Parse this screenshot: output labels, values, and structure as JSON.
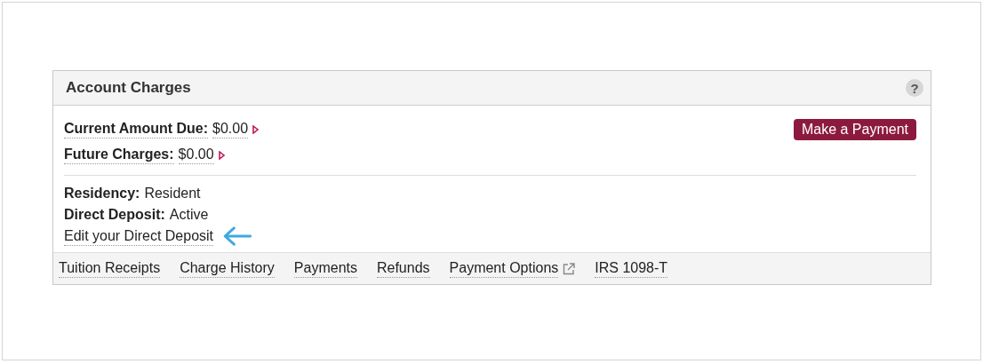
{
  "panel": {
    "title": "Account Charges",
    "help": "?"
  },
  "amounts": [
    {
      "label": "Current Amount Due:",
      "value": "$0.00"
    },
    {
      "label": "Future Charges:",
      "value": "$0.00"
    }
  ],
  "pay_button": "Make a Payment",
  "details": [
    {
      "label": "Residency:",
      "value": "Resident"
    },
    {
      "label": "Direct Deposit:",
      "value": "Active"
    }
  ],
  "edit_link": {
    "label": "Edit your Direct Deposit",
    "pointer_arrow": true
  },
  "footer_links": [
    {
      "label": "Tuition Receipts",
      "external": false
    },
    {
      "label": "Charge History",
      "external": false
    },
    {
      "label": "Payments",
      "external": false
    },
    {
      "label": "Refunds",
      "external": false
    },
    {
      "label": "Payment Options",
      "external": true
    },
    {
      "label": "IRS 1098-T",
      "external": false
    }
  ]
}
